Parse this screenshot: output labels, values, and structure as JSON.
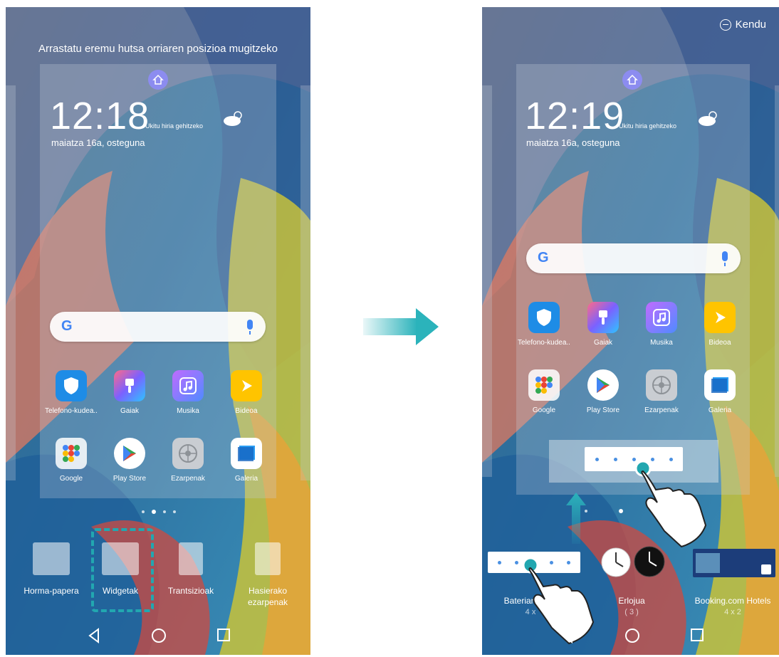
{
  "left": {
    "hint": "Arrastatu eremu hutsa orriaren posizioa mugitzeko",
    "clock": "12:18",
    "city_hint": "Ukitu hiria gehitzeko",
    "date": "maiatza 16a, osteguna",
    "apps_row1": [
      "Telefono-kudea..",
      "Gaiak",
      "Musika",
      "Bideoa"
    ],
    "apps_row2": [
      "Google",
      "Play Store",
      "Ezarpenak",
      "Galeria"
    ],
    "options": [
      "Horma-papera",
      "Widgetak",
      "Trantsizioak",
      "Hasierako ezarpenak"
    ]
  },
  "right": {
    "remove_label": "Kendu",
    "clock": "12:19",
    "city_hint": "Ukitu hiria gehitzeko",
    "date": "maiatza 16a, osteguna",
    "apps_row1": [
      "Telefono-kudea..",
      "Gaiak",
      "Musika",
      "Bideoa"
    ],
    "apps_row2": [
      "Google",
      "Play Store",
      "Ezarpenak",
      "Galeria"
    ],
    "widgets": [
      {
        "name": "Bateriaren k...",
        "size": "4 x"
      },
      {
        "name": "Erlojua",
        "size": "( 3 )"
      },
      {
        "name": "Booking.com Hotels",
        "size": "4 x 2"
      }
    ]
  },
  "colors": {
    "accent": "#22a7b0",
    "icon_purple": "#8c8cf0"
  }
}
